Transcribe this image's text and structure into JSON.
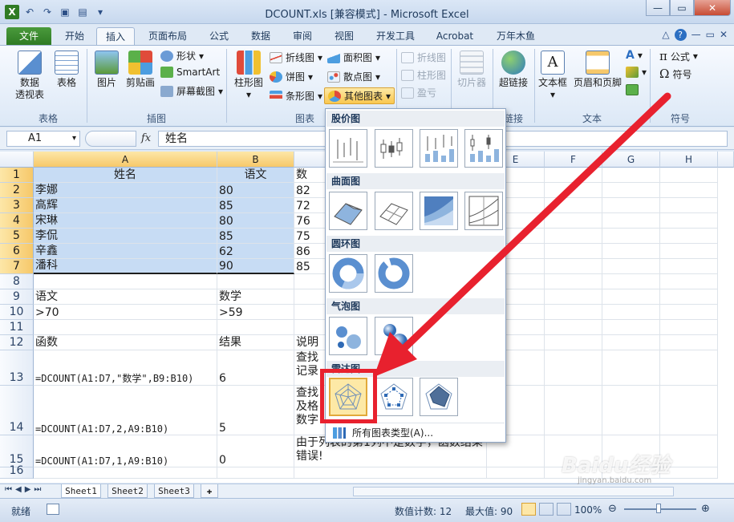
{
  "window": {
    "title": "DCOUNT.xls  [兼容模式]  -  Microsoft Excel"
  },
  "tabs": [
    "文件",
    "开始",
    "插入",
    "页面布局",
    "公式",
    "数据",
    "审阅",
    "视图",
    "开发工具",
    "Acrobat",
    "万年木鱼"
  ],
  "active_tab": "插入",
  "ribbon": {
    "groups": {
      "table": "表格",
      "illustration": "插图",
      "chart": "图表",
      "sparkline": "迷你图",
      "filter": "筛选器",
      "link": "链接",
      "text": "文本",
      "symbol": "符号"
    },
    "buttons": {
      "pivot": "数据\n透视表",
      "pivot_l1": "数据",
      "pivot_l2": "透视表",
      "table": "表格",
      "picture": "图片",
      "clipart": "剪贴画",
      "shapes": "形状",
      "smartart": "SmartArt",
      "screenshot": "屏幕截图",
      "column": "柱形图",
      "line": "折线图",
      "pie": "饼图",
      "bar": "条形图",
      "area": "面积图",
      "scatter": "散点图",
      "other": "其他图表",
      "spark_line": "折线图",
      "spark_col": "柱形图",
      "spark_wl": "盈亏",
      "slicer": "切片器",
      "hyperlink": "超链接",
      "textbox": "文本框",
      "header": "页眉和页脚",
      "equation": "公式",
      "symbol": "符号"
    }
  },
  "formula_bar": {
    "name_box": "A1",
    "fx": "fx",
    "content": "姓名"
  },
  "columns": [
    "A",
    "B",
    "",
    "D",
    "E",
    "F",
    "G",
    "H"
  ],
  "rows": [
    {
      "n": "1",
      "a": "姓名",
      "b": "语文",
      "c": "数"
    },
    {
      "n": "2",
      "a": "李娜",
      "b": "80",
      "c": "82"
    },
    {
      "n": "3",
      "a": "高辉",
      "b": "85",
      "c": "72"
    },
    {
      "n": "4",
      "a": "宋琳",
      "b": "80",
      "c": "76"
    },
    {
      "n": "5",
      "a": "李侃",
      "b": "85",
      "c": "75"
    },
    {
      "n": "6",
      "a": "辛鑫",
      "b": "62",
      "c": "86"
    },
    {
      "n": "7",
      "a": "潘科",
      "b": "90",
      "c": "85"
    },
    {
      "n": "8",
      "a": "",
      "b": "",
      "c": ""
    },
    {
      "n": "9",
      "a": "语文",
      "b": "数学",
      "c": ""
    },
    {
      "n": "10",
      "a": ">70",
      "b": ">59",
      "c": ""
    },
    {
      "n": "11",
      "a": "",
      "b": "",
      "c": ""
    },
    {
      "n": "12",
      "a": "函数",
      "b": "结果",
      "c": "说明"
    },
    {
      "n": "13",
      "a": "=DCOUNT(A1:D7,\"数学\",B9:B10)",
      "b": "6",
      "c": "查找\n记录"
    },
    {
      "n": "14",
      "a": "=DCOUNT(A1:D7,2,A9:B10)",
      "b": "5",
      "c": "查找\n及格\n数字"
    },
    {
      "n": "15",
      "a": "=DCOUNT(A1:D7,1,A9:B10)",
      "b": "0",
      "c": "由于列表的第1列不是数字，函数结果错误!"
    },
    {
      "n": "16",
      "a": "",
      "b": "",
      "c": ""
    }
  ],
  "gallery": {
    "sections": [
      "股价图",
      "曲面图",
      "圆环图",
      "气泡图",
      "雷达图"
    ],
    "footer": "所有图表类型(A)..."
  },
  "sheets": [
    "Sheet1",
    "Sheet2",
    "Sheet3"
  ],
  "status": {
    "mode": "就绪",
    "count": "数值计数: 12",
    "max": "最大值: 90",
    "zoom": "100%"
  },
  "watermark": {
    "brand": "Baidu经验",
    "url": "jingyan.baidu.com"
  },
  "colors": {
    "accent_green": "#2f7b24",
    "selection": "#c7dcf4",
    "highlight_red": "#e8212e"
  }
}
